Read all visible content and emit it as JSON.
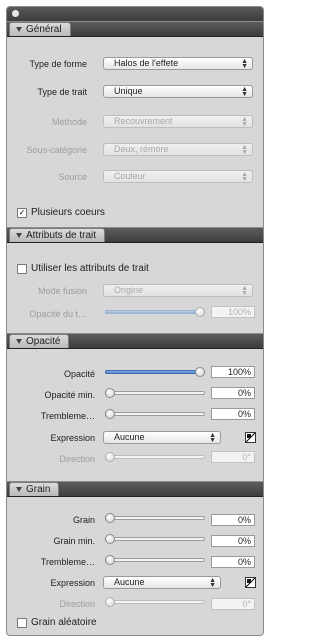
{
  "sections": {
    "general": {
      "title": "Général",
      "form_type_label": "Type de forme",
      "form_type_value": "Halos de l'effete",
      "stroke_type_label": "Type de trait",
      "stroke_type_value": "Unique",
      "method_label": "Méthode",
      "method_value": "Recouvrement",
      "subcategory_label": "Sous-catégorie",
      "subcategory_value": "Deux, rémore",
      "source_label": "Source",
      "source_value": "Couleur",
      "multiple_layers_label": "Plusieurs coeurs"
    },
    "stroke_attributes": {
      "title": "Attributs de trait",
      "use_attributes_label": "Utiliser les attributs de trait",
      "fusion_mode_label": "Mode fusion",
      "fusion_mode_value": "Origine",
      "opacity_label": "Opacité du t…",
      "opacity_value": "100%",
      "opacity_fraction": 1.0
    },
    "opacity": {
      "title": "Opacité",
      "opacity_label": "Opacité",
      "opacity_value": "100%",
      "opacity_fraction": 1.0,
      "opacity_min_label": "Opacité min.",
      "opacity_min_value": "0%",
      "opacity_min_fraction": 0.0,
      "tremble_label": "Trembleme…",
      "tremble_value": "0%",
      "tremble_fraction": 0.0,
      "expression_label": "Expression",
      "expression_value": "Aucune",
      "direction_label": "Direction",
      "direction_value": "0°",
      "direction_fraction": 0.0
    },
    "grain": {
      "title": "Grain",
      "grain_label": "Grain",
      "grain_value": "0%",
      "grain_fraction": 0.0,
      "grain_min_label": "Grain min.",
      "grain_min_value": "0%",
      "grain_min_fraction": 0.0,
      "tremble_label": "Trembleme…",
      "tremble_value": "0%",
      "tremble_fraction": 0.0,
      "expression_label": "Expression",
      "expression_value": "Aucune",
      "direction_label": "Direction",
      "direction_value": "0°",
      "direction_fraction": 0.0,
      "random_grain_label": "Grain aléatoire"
    }
  },
  "checkmark_glyph": "✓",
  "select_arrows_glyph": "▲▼",
  "icons": [
    "close-icon",
    "disclosure-triangle-icon",
    "gradient-editor-icon",
    "slider-thumb-icon"
  ],
  "colors": {
    "panel_bg": "#d7d7d7",
    "header_dark": "#3d3d3d",
    "slider_fill": "#4c84cc",
    "disabled_text": "#9d9d9d"
  }
}
